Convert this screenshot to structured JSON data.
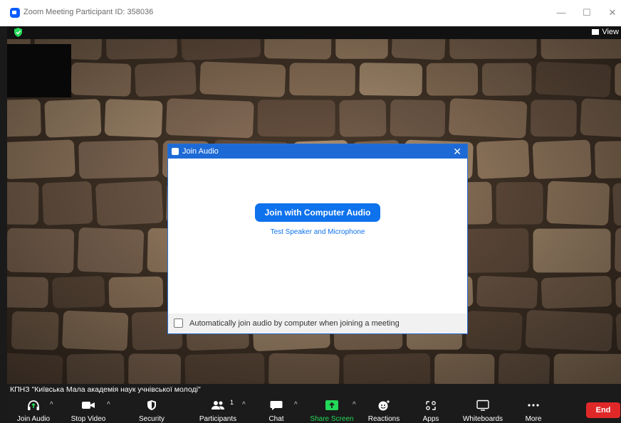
{
  "window": {
    "title": "Zoom Meeting Participant ID: 358036"
  },
  "topbar": {
    "view_label": "View"
  },
  "participant": {
    "name": "КПНЗ \"Київська Мала академія наук учнівської молоді\""
  },
  "toolbar": {
    "items": [
      {
        "label": "Join Audio",
        "icon": "headphones-icon",
        "caret": true
      },
      {
        "label": "Stop Video",
        "icon": "video-camera-icon",
        "caret": true
      },
      {
        "label": "Security",
        "icon": "shield-icon",
        "caret": false
      },
      {
        "label": "Participants",
        "icon": "participants-icon",
        "caret": true,
        "count": "1"
      },
      {
        "label": "Chat",
        "icon": "chat-icon",
        "caret": true
      },
      {
        "label": "Share Screen",
        "icon": "share-screen-icon",
        "caret": true
      },
      {
        "label": "Reactions",
        "icon": "reactions-icon",
        "caret": false
      },
      {
        "label": "Apps",
        "icon": "apps-icon",
        "caret": false
      },
      {
        "label": "Whiteboards",
        "icon": "whiteboard-icon",
        "caret": false
      },
      {
        "label": "More",
        "icon": "more-icon",
        "caret": false
      }
    ],
    "end_label": "End"
  },
  "dialog": {
    "title": "Join Audio",
    "join_button": "Join with Computer Audio",
    "test_link": "Test Speaker and Microphone",
    "auto_join_label": "Automatically join audio by computer when joining a meeting",
    "auto_join_checked": false
  },
  "colors": {
    "accent": "#0e72ed",
    "dialog_title_bar": "#1d6ad6",
    "share_screen_green": "#23d959",
    "end_red": "#e02828",
    "toolbar_bg": "#1b1b1b"
  }
}
